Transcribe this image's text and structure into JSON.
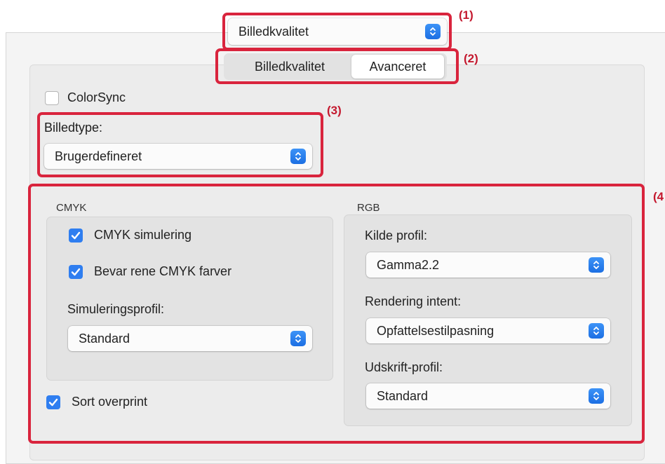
{
  "top_popup": {
    "value": "Billedkvalitet"
  },
  "tabs": [
    {
      "label": "Billedkvalitet",
      "selected": false
    },
    {
      "label": "Avanceret",
      "selected": true
    }
  ],
  "colorsync": {
    "label": "ColorSync",
    "checked": false
  },
  "image_type": {
    "label": "Billedtype:",
    "value": "Brugerdefineret"
  },
  "cmyk": {
    "title": "CMYK",
    "simulation": {
      "label": "CMYK simulering",
      "checked": true
    },
    "preserve": {
      "label": "Bevar rene CMYK farver",
      "checked": true
    },
    "profile_label": "Simuleringsprofil:",
    "profile_value": "Standard"
  },
  "black_overprint": {
    "label": "Sort overprint",
    "checked": true
  },
  "rgb": {
    "title": "RGB",
    "source_label": "Kilde profil:",
    "source_value": "Gamma2.2",
    "intent_label": "Rendering intent:",
    "intent_value": "Opfattelsestilpasning",
    "output_label": "Udskrift-profil:",
    "output_value": "Standard"
  },
  "callouts": [
    "(1)",
    "(2)",
    "(3)",
    "(4"
  ],
  "colors": {
    "accent": "#2f7ef0",
    "callout": "#d9243d",
    "window": "#f4f4f4",
    "panel": "#ececec"
  }
}
